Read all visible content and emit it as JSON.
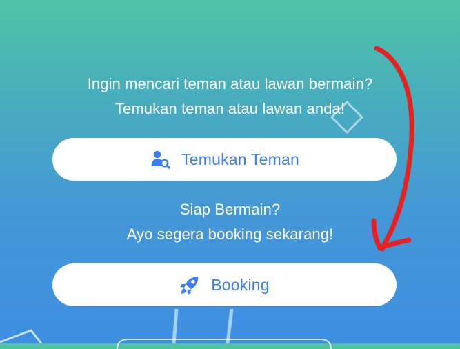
{
  "intro": {
    "line1": "Ingin mencari teman atau lawan bermain?",
    "line2": "Temukan teman atau lawan anda!"
  },
  "find_friends_button": {
    "label": "Temukan Teman",
    "icon": "user-search-icon"
  },
  "booking_intro": {
    "line1": "Siap Bermain?",
    "line2": "Ayo segera booking sekarang!"
  },
  "booking_button": {
    "label": "Booking",
    "icon": "rocket-icon"
  },
  "colors": {
    "button_text": "#3a7ef0",
    "annotation_arrow": "#e52222",
    "background_top": "#4fc3a6",
    "background_bottom": "#3e8ee2"
  }
}
